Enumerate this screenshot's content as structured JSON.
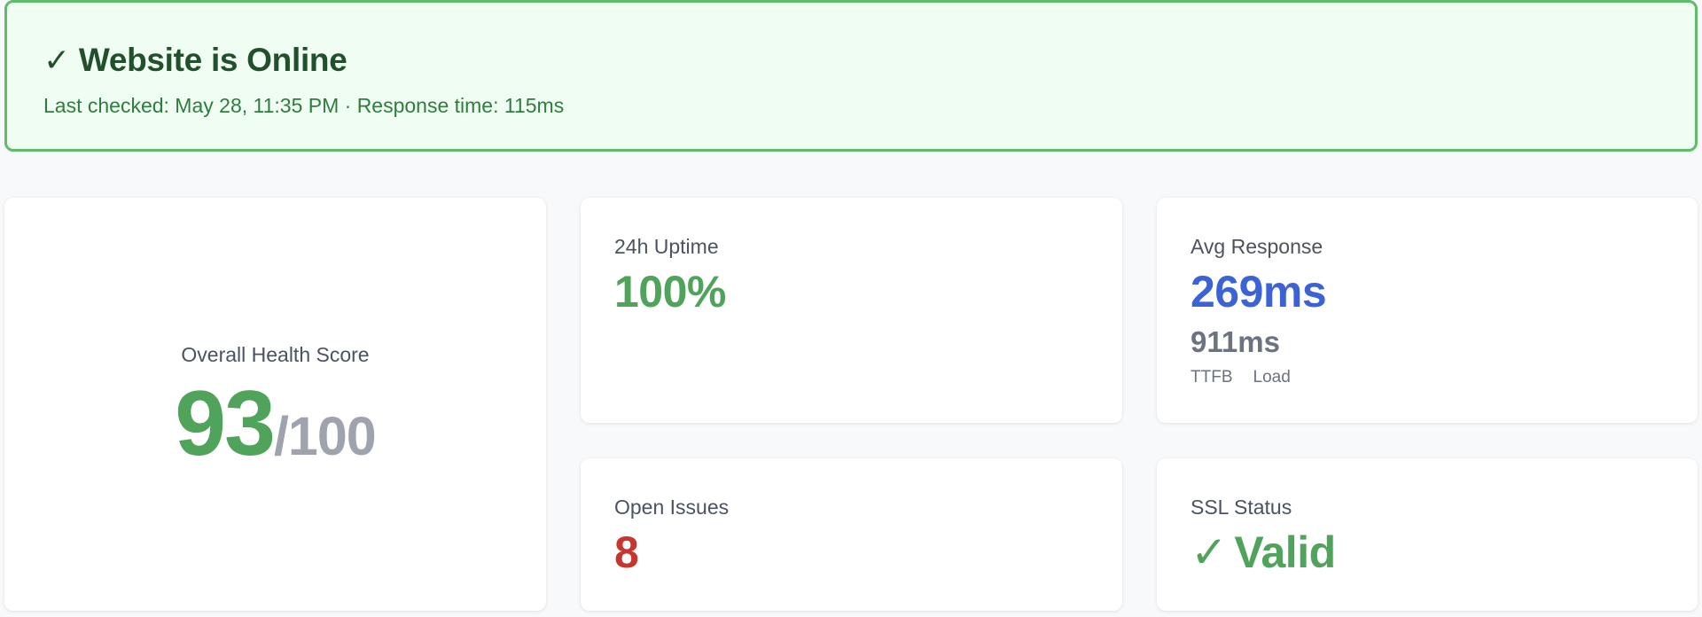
{
  "status": {
    "check_icon": "✓",
    "title": "Website is Online",
    "subtitle": "Last checked: May 28, 11:35 PM · Response time: 115ms"
  },
  "health": {
    "label": "Overall Health Score",
    "score": "93",
    "denominator": "/100"
  },
  "uptime": {
    "label": "24h Uptime",
    "value": "100%"
  },
  "response": {
    "label": "Avg Response",
    "primary_value": "269ms",
    "secondary_value": "911ms",
    "caption_primary": "TTFB",
    "caption_secondary": "Load"
  },
  "issues": {
    "label": "Open Issues",
    "value": "8"
  },
  "ssl": {
    "label": "SSL Status",
    "check_icon": "✓",
    "value": "Valid"
  },
  "colors": {
    "success": "#4fa35a",
    "info": "#3b63d6",
    "danger": "#c8342e",
    "banner_border": "#5cbd6a",
    "banner_bg": "#f0fdf2"
  }
}
